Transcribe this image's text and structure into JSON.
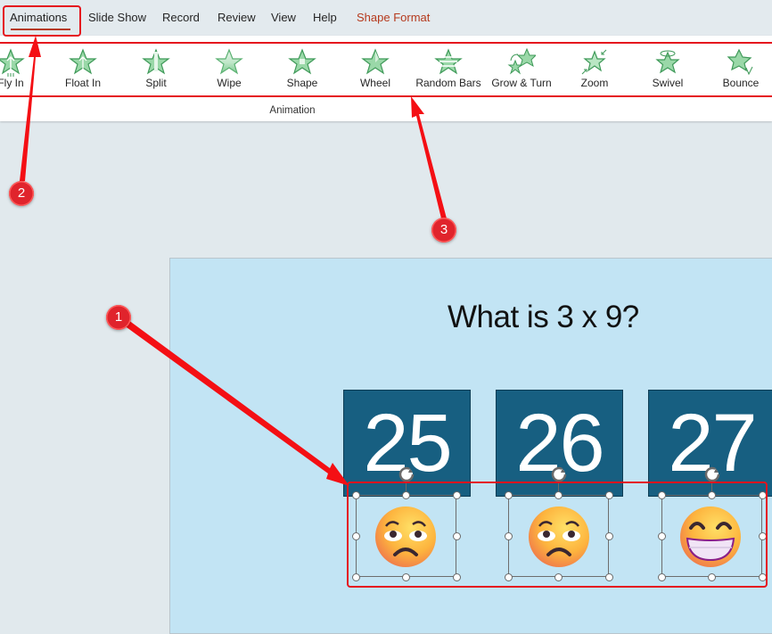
{
  "tabs": [
    {
      "label": "Animations",
      "active": true
    },
    {
      "label": "Slide Show"
    },
    {
      "label": "Record"
    },
    {
      "label": "Review"
    },
    {
      "label": "View"
    },
    {
      "label": "Help"
    },
    {
      "label": "Shape Format",
      "contextual": true
    }
  ],
  "ribbon": {
    "group_label": "Animation",
    "effects": [
      {
        "label": "Fly In",
        "icon": "fly-in-star-icon"
      },
      {
        "label": "Float In",
        "icon": "float-in-star-icon"
      },
      {
        "label": "Split",
        "icon": "split-star-icon"
      },
      {
        "label": "Wipe",
        "icon": "wipe-star-icon"
      },
      {
        "label": "Shape",
        "icon": "shape-star-icon"
      },
      {
        "label": "Wheel",
        "icon": "wheel-star-icon"
      },
      {
        "label": "Random Bars",
        "icon": "random-bars-star-icon"
      },
      {
        "label": "Grow & Turn",
        "icon": "grow-turn-star-icon"
      },
      {
        "label": "Zoom",
        "icon": "zoom-star-icon"
      },
      {
        "label": "Swivel",
        "icon": "swivel-star-icon"
      },
      {
        "label": "Bounce",
        "icon": "bounce-star-icon"
      }
    ]
  },
  "slide": {
    "title": "What is 3 x 9?",
    "answers": [
      {
        "number": "25",
        "emoji": "unamused-face",
        "selected": true
      },
      {
        "number": "26",
        "emoji": "unamused-face",
        "selected": true
      },
      {
        "number": "27",
        "emoji": "grinning-face",
        "selected": true
      }
    ]
  },
  "annotations": {
    "badges": [
      "1",
      "2",
      "3"
    ]
  },
  "colors": {
    "accent_tab": "#b5391c",
    "answer_box": "#175f81",
    "slide_bg": "#c2e4f4",
    "annotation_red": "#e5141e",
    "star_green": "#4fae68"
  }
}
